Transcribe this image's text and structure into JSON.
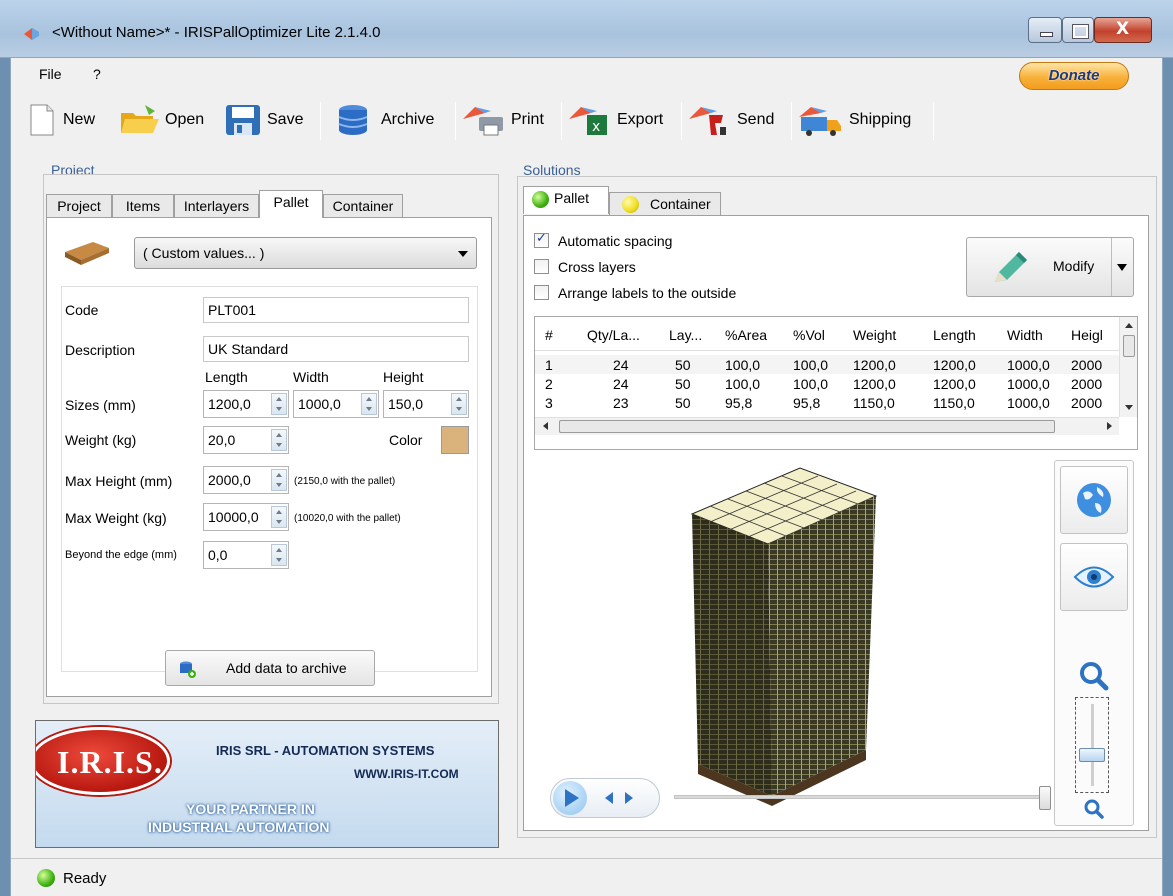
{
  "window": {
    "title": "<Without Name>* - IRISPallOptimizer Lite 2.1.4.0"
  },
  "menu": {
    "file": "File",
    "help": "?"
  },
  "donate_label": "Donate",
  "toolbar": {
    "new": "New",
    "open": "Open",
    "save": "Save",
    "archive": "Archive",
    "print": "Print",
    "export": "Export",
    "send": "Send",
    "shipping": "Shipping"
  },
  "project": {
    "group_label": "Project",
    "tabs": [
      "Project",
      "Items",
      "Interlayers",
      "Pallet",
      "Container"
    ],
    "active_tab": "Pallet",
    "preset": "( Custom values... )",
    "code_label": "Code",
    "code_value": "PLT001",
    "description_label": "Description",
    "description_value": "UK Standard",
    "length_header": "Length",
    "width_header": "Width",
    "height_header": "Height",
    "sizes_label": "Sizes (mm)",
    "length_value": "1200,0",
    "width_value": "1000,0",
    "height_value": "150,0",
    "weight_label": "Weight (kg)",
    "weight_value": "20,0",
    "color_label": "Color",
    "color_hex": "#d9b27c",
    "max_height_label": "Max Height (mm)",
    "max_height_value": "2000,0",
    "max_height_note": "(2150,0 with the pallet)",
    "max_weight_label": "Max Weight (kg)",
    "max_weight_value": "10000,0",
    "max_weight_note": "(10020,0 with the pallet)",
    "beyond_label": "Beyond the edge (mm)",
    "beyond_value": "0,0",
    "add_archive": "Add data to archive"
  },
  "banner": {
    "logo": "I.R.I.S.",
    "company": "IRIS SRL  - AUTOMATION SYSTEMS",
    "website": "WWW.IRIS-IT.COM",
    "tagline_1": "YOUR PARTNER IN",
    "tagline_2": "INDUSTRIAL AUTOMATION"
  },
  "solutions": {
    "group_label": "Solutions",
    "tabs": [
      "Pallet",
      "Container"
    ],
    "auto_spacing": "Automatic spacing",
    "cross_layers": "Cross layers",
    "arrange_labels": "Arrange labels to the outside",
    "modify": "Modify",
    "columns": [
      "#",
      "Qty/La...",
      "Lay...",
      "%Area",
      "%Vol",
      "Weight",
      "Length",
      "Width",
      "Heigl"
    ],
    "rows": [
      [
        "1",
        "24",
        "50",
        "100,0",
        "100,0",
        "1200,0",
        "1200,0",
        "1000,0",
        "2000"
      ],
      [
        "2",
        "24",
        "50",
        "100,0",
        "100,0",
        "1200,0",
        "1200,0",
        "1000,0",
        "2000"
      ],
      [
        "3",
        "23",
        "50",
        "95,8",
        "95,8",
        "1150,0",
        "1150,0",
        "1000,0",
        "2000"
      ]
    ]
  },
  "status": "Ready",
  "colors": {
    "accent": "#3a5f9a",
    "banner_bg": "#d6e6f4",
    "logo_red": "#c8201f",
    "box_top": "#f3efc9",
    "box_side": "#353421"
  }
}
